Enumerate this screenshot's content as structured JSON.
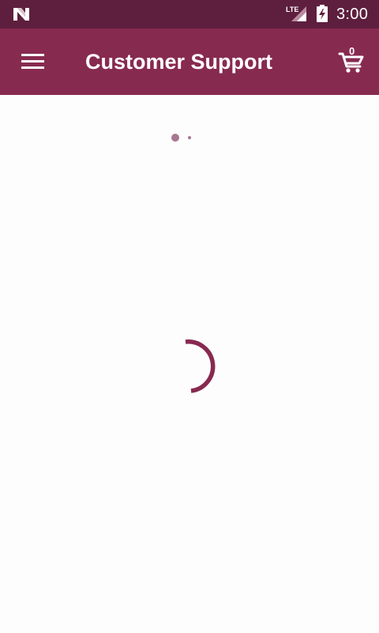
{
  "status_bar": {
    "time": "3:00",
    "network_label": "LTE",
    "icons": [
      "n-logo-icon",
      "lte-signal-icon",
      "battery-charging-icon"
    ]
  },
  "app_bar": {
    "title": "Customer Support",
    "menu_icon": "hamburger-menu-icon",
    "cart_icon": "shopping-cart-icon",
    "cart_count": "0"
  },
  "content": {
    "page_indicator_icon": "loading-dots-icon",
    "spinner_icon": "loading-spinner-icon"
  },
  "colors": {
    "status_bar": "#5e1f3e",
    "app_bar": "#872a50",
    "background": "#fdfdfd",
    "spinner": "#872a50",
    "dots": "#a87790"
  }
}
